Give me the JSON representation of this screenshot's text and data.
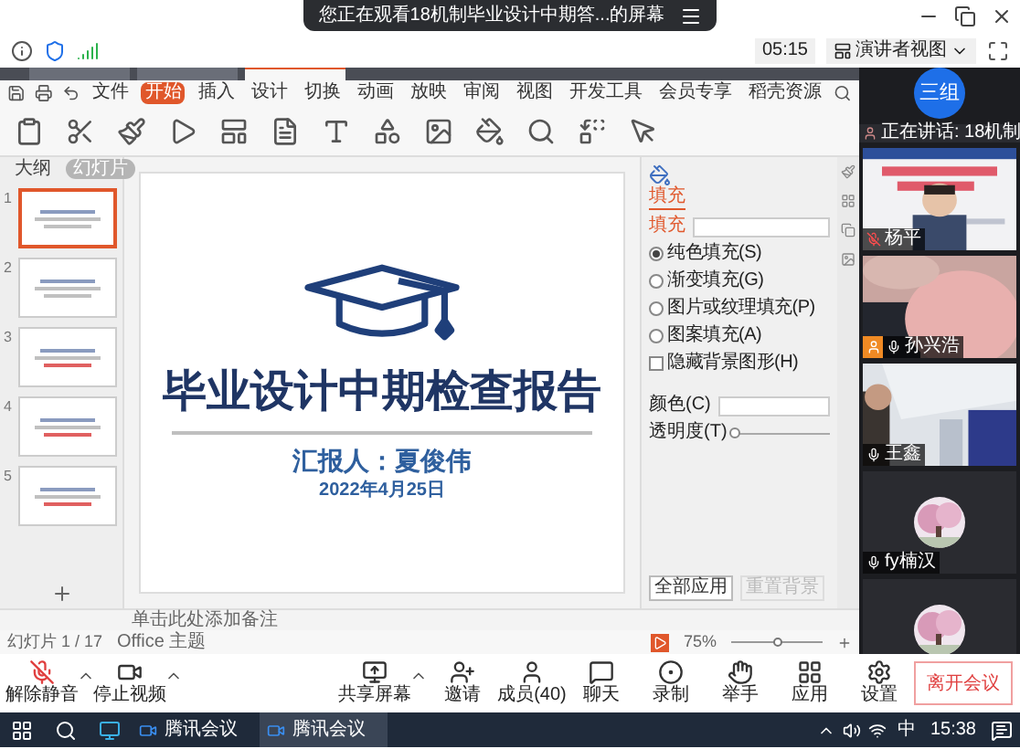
{
  "banner": {
    "text": "您正在观看18机制毕业设计中期答...的屏幕"
  },
  "meeting_info": {
    "timer": "05:15",
    "view_button": "演讲者视图"
  },
  "document_tabs": [
    {
      "selected": false
    },
    {
      "selected": false
    },
    {
      "selected": true
    }
  ],
  "ribbon_tabs": [
    {
      "label": "文件",
      "selected": false
    },
    {
      "label": "开始",
      "selected": true
    },
    {
      "label": "插入",
      "selected": false
    },
    {
      "label": "设计",
      "selected": false
    },
    {
      "label": "切换",
      "selected": false
    },
    {
      "label": "动画",
      "selected": false
    },
    {
      "label": "放映",
      "selected": false
    },
    {
      "label": "审阅",
      "selected": false
    },
    {
      "label": "视图",
      "selected": false
    },
    {
      "label": "开发工具",
      "selected": false
    },
    {
      "label": "会员专享",
      "selected": false
    },
    {
      "label": "稻壳资源",
      "selected": false
    }
  ],
  "panel_tabs": [
    {
      "label": "大纲",
      "selected": false
    },
    {
      "label": "幻灯片",
      "selected": true
    }
  ],
  "thumbnails": [
    {
      "number": "1",
      "selected": true
    },
    {
      "number": "2",
      "selected": false
    },
    {
      "number": "3",
      "selected": false
    },
    {
      "number": "4",
      "selected": false
    },
    {
      "number": "5",
      "selected": false
    }
  ],
  "slide": {
    "title": "毕业设计中期检查报告",
    "presenter": "汇报人：夏俊伟",
    "date": "2022年4月25日"
  },
  "properties": {
    "tab": "填充",
    "section": "填充",
    "options": [
      {
        "label": "纯色填充(S)",
        "kind": "radio",
        "selected": true
      },
      {
        "label": "渐变填充(G)",
        "kind": "radio",
        "selected": false
      },
      {
        "label": "图片或纹理填充(P)",
        "kind": "radio",
        "selected": false
      },
      {
        "label": "图案填充(A)",
        "kind": "radio",
        "selected": false
      },
      {
        "label": "隐藏背景图形(H)",
        "kind": "checkbox",
        "checked": false
      }
    ],
    "color_label": "颜色(C)",
    "opacity_label": "透明度(T)",
    "opacity": {
      "level": 0
    },
    "buttons": [
      {
        "label": "全部应用",
        "disabled": false
      },
      {
        "label": "重置背景",
        "disabled": true
      }
    ]
  },
  "notes_placeholder": "单击此处添加备注",
  "status_bar": {
    "slide_count": "幻灯片 1 / 17",
    "theme": "Office 主题",
    "zoom": "75%",
    "zoom_slider": {
      "level": 0.5
    }
  },
  "participants": {
    "group": "三组",
    "speaking": "正在讲话: 18机制",
    "tiles": [
      {
        "kind": "slide",
        "name": "杨平",
        "muted": true,
        "host": false
      },
      {
        "kind": "closeup",
        "name": "孙兴浩",
        "muted": false,
        "host": true
      },
      {
        "kind": "room",
        "name": "王鑫",
        "muted": false,
        "host": false
      },
      {
        "kind": "avatar",
        "name": "fy楠汉",
        "muted": false,
        "host": false
      },
      {
        "kind": "avatar"
      }
    ]
  },
  "toolbar": [
    {
      "kind": "mic",
      "label": "解除静音",
      "muted": true,
      "has_menu": true
    },
    {
      "kind": "video",
      "label": "停止视频",
      "has_menu": true
    },
    {
      "kind": "share",
      "label": "共享屏幕",
      "has_menu": true
    },
    {
      "kind": "invite",
      "label": "邀请",
      "has_menu": false
    },
    {
      "kind": "members",
      "label": "成员(40)",
      "has_menu": false
    },
    {
      "kind": "chat",
      "label": "聊天",
      "has_menu": false
    },
    {
      "kind": "record",
      "label": "录制",
      "has_menu": false
    },
    {
      "kind": "hand",
      "label": "举手",
      "has_menu": false
    },
    {
      "kind": "apps",
      "label": "应用",
      "has_menu": false
    },
    {
      "kind": "settings",
      "label": "设置",
      "has_menu": false
    }
  ],
  "leave_button": "离开会议",
  "taskbar": {
    "apps": [
      {
        "label": "腾讯会议",
        "selected": false
      },
      {
        "label": "腾讯会议",
        "selected": true
      }
    ],
    "ime": "中",
    "clock": "15:38"
  }
}
